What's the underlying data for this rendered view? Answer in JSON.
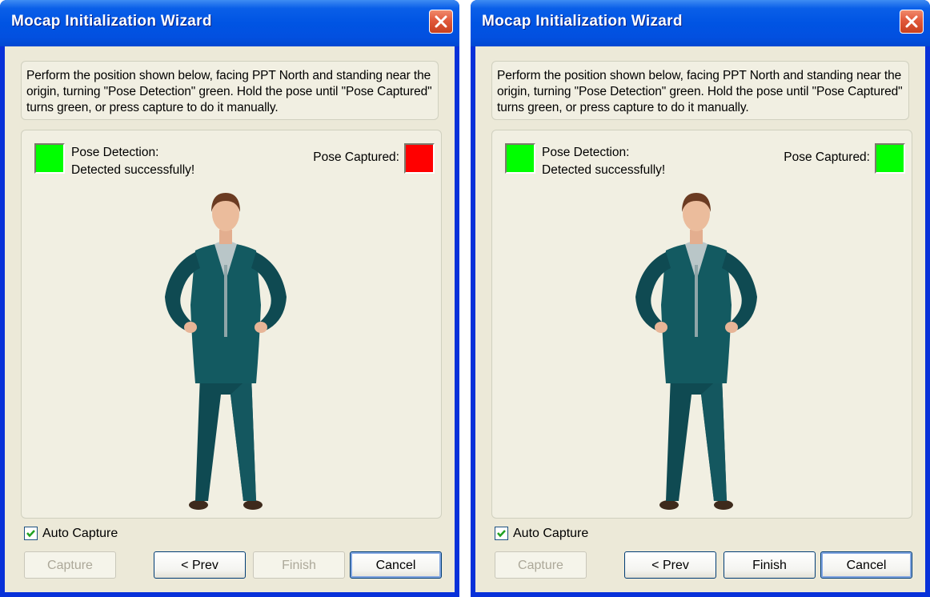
{
  "windows": [
    {
      "title": "Mocap Initialization Wizard",
      "instructions": "Perform the position shown below, facing PPT North and standing near the origin, turning \"Pose Detection\" green. Hold the pose until \"Pose Captured\" turns green, or press capture to do it manually.",
      "pose_detection_label": "Pose Detection:",
      "pose_detection_status": "Detected successfully!",
      "pose_detection_color": "#00ff00",
      "pose_captured_label": "Pose Captured:",
      "pose_captured_color": "#ff0000",
      "auto_capture_label": "Auto Capture",
      "auto_capture_checked": true,
      "buttons": {
        "capture": "Capture",
        "prev": "< Prev",
        "finish": "Finish",
        "cancel": "Cancel"
      },
      "finish_enabled": false
    },
    {
      "title": "Mocap Initialization Wizard",
      "instructions": "Perform the position shown below, facing PPT North and standing near the origin, turning \"Pose Detection\" green. Hold the pose until \"Pose Captured\" turns green, or press capture to do it manually.",
      "pose_detection_label": "Pose Detection:",
      "pose_detection_status": "Detected successfully!",
      "pose_detection_color": "#00ff00",
      "pose_captured_label": "Pose Captured:",
      "pose_captured_color": "#00ff00",
      "auto_capture_label": "Auto Capture",
      "auto_capture_checked": true,
      "buttons": {
        "capture": "Capture",
        "prev": "< Prev",
        "finish": "Finish",
        "cancel": "Cancel"
      },
      "finish_enabled": true
    }
  ],
  "icons": {
    "close": "close-icon",
    "checkmark": "checkmark-icon",
    "pose_figure": "pose-figure-image"
  }
}
